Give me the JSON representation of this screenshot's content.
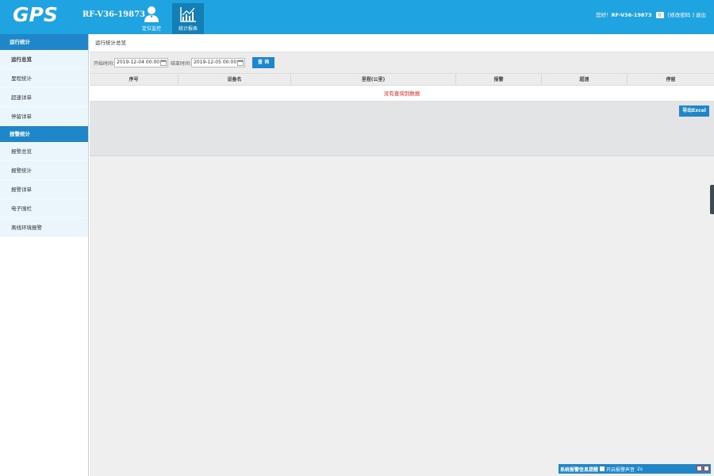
{
  "header": {
    "logo": "GPS",
    "device_id": "RF-V36-19873",
    "nav": [
      {
        "label": "定位监控",
        "icon": "person-icon"
      },
      {
        "label": "统计报表",
        "icon": "line-chart-icon"
      }
    ],
    "user": {
      "greeting": "您好！",
      "name": "RF-V36-19873",
      "msg_count": "0",
      "change_password": "[修改密码",
      "logout": "] 退出"
    }
  },
  "sidebar": {
    "groups": [
      {
        "title": "运行统计",
        "items": [
          "运行总览",
          "里程统计",
          "超速详单",
          "停留详单"
        ]
      },
      {
        "title": "报警统计",
        "items": [
          "报警总览",
          "报警统计",
          "报警详单",
          "电子围栏",
          "离线环境报警"
        ]
      }
    ]
  },
  "main": {
    "breadcrumb": "运行统计总览",
    "filter": {
      "start_label": "开始时间:",
      "start_value": "2019-12-04 00:00",
      "end_label": "结束时间:",
      "end_value": "2019-12-05 00:00",
      "query_button": "查 询"
    },
    "table": {
      "columns": [
        "序号",
        "设备名",
        "里程(公里)",
        "报警",
        "超速",
        "停留"
      ],
      "empty_message": "没有查询到数据"
    },
    "export_button": "导出Excel"
  },
  "alarm_bar": {
    "title": "系统报警信息提醒",
    "sound_label": "开启报警声音",
    "interval": "2s"
  },
  "colors": {
    "header_bg": "#1fa3e1",
    "accent": "#1f86c9",
    "sidebar_bg": "#eaf5fc",
    "error_text": "#e8211c"
  }
}
